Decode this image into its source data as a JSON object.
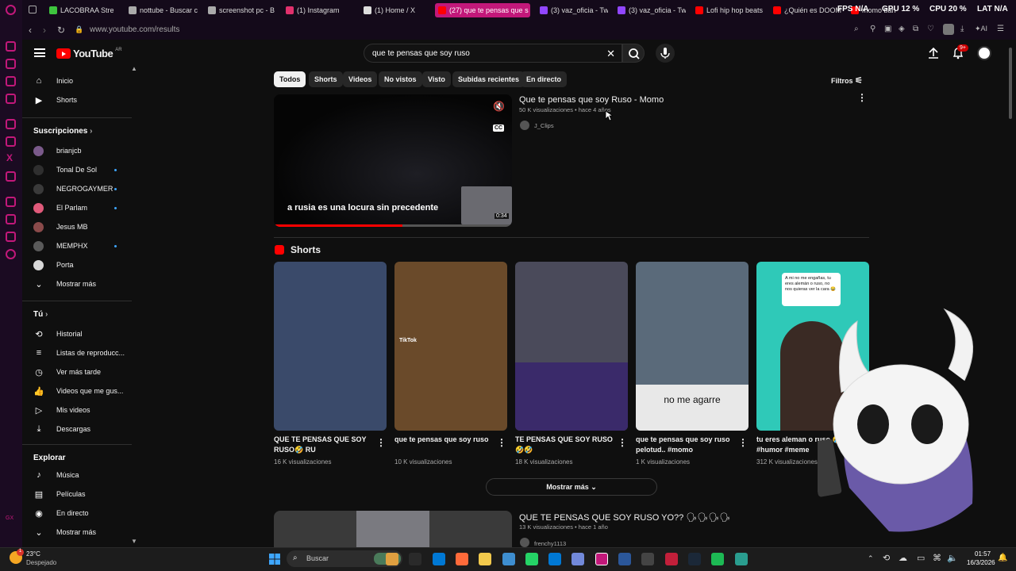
{
  "browser": {
    "tabs": [
      {
        "label": "LACOBRAA Stre",
        "color": "#3ec43e"
      },
      {
        "label": "nottube - Buscar c",
        "color": "#aaaaaa"
      },
      {
        "label": "screenshot pc - B",
        "color": "#aaaaaa"
      },
      {
        "label": "(1) Instagram",
        "color": "#e1306c"
      },
      {
        "label": "(1) Home / X",
        "color": "#dddddd"
      },
      {
        "label": "(27) que te pensas que s",
        "color": "#ff0000"
      },
      {
        "label": "(3) vaz_oficia - Tw",
        "color": "#9146ff"
      },
      {
        "label": "(3) vaz_oficia - Tw",
        "color": "#9146ff"
      },
      {
        "label": "Lofi hip hop beats",
        "color": "#ff0000"
      },
      {
        "label": "¿Quién es DOOM",
        "color": "#ff0000"
      },
      {
        "label": "momo banea a un",
        "color": "#ff0000"
      }
    ],
    "url": "www.youtube.com/results",
    "hud": {
      "fps_label": "FPS",
      "fps": "N/A",
      "gpu_label": "GPU",
      "gpu": "12 %",
      "cpu_label": "CPU",
      "cpu": "20 %",
      "lat_label": "LAT",
      "lat": "N/A"
    },
    "ai_label": "AI"
  },
  "youtube": {
    "logo": "YouTube",
    "region": "AR",
    "search_query": "que te pensas que soy ruso",
    "notification_count": "9+",
    "sidebar": {
      "main": [
        {
          "label": "Inicio",
          "icon": "home-icon"
        },
        {
          "label": "Shorts",
          "icon": "shorts-icon"
        }
      ],
      "subs_title": "Suscripciones",
      "subs": [
        {
          "label": "brianjcb",
          "color": "#7a5a8a",
          "dot": false
        },
        {
          "label": "Tonal De Sol",
          "color": "#2f2f2f",
          "dot": true
        },
        {
          "label": "NEGROGAYMER",
          "color": "#3a3a3a",
          "dot": true
        },
        {
          "label": "El Parlam",
          "color": "#e05a7a",
          "dot": true
        },
        {
          "label": "Jesus MB",
          "color": "#8a4a4a",
          "dot": false
        },
        {
          "label": "MEMPHX",
          "color": "#5a5a5a",
          "dot": true
        },
        {
          "label": "Porta",
          "color": "#d8d8d8",
          "dot": false
        }
      ],
      "subs_more": "Mostrar más",
      "you_title": "Tú",
      "you": [
        {
          "label": "Historial",
          "icon": "history-icon"
        },
        {
          "label": "Listas de reproducc...",
          "icon": "playlist-icon"
        },
        {
          "label": "Ver más tarde",
          "icon": "clock-icon"
        },
        {
          "label": "Videos que me gus...",
          "icon": "thumbs-up-icon"
        },
        {
          "label": "Mis videos",
          "icon": "my-videos-icon"
        },
        {
          "label": "Descargas",
          "icon": "download-icon"
        }
      ],
      "explore_title": "Explorar",
      "explore": [
        {
          "label": "Música",
          "icon": "music-icon"
        },
        {
          "label": "Películas",
          "icon": "film-icon"
        },
        {
          "label": "En directo",
          "icon": "live-icon"
        }
      ],
      "explore_more": "Mostrar más"
    },
    "chips": [
      "Todos",
      "Shorts",
      "Videos",
      "No vistos",
      "Visto",
      "Subidas recientes",
      "En directo"
    ],
    "filters": "Filtros",
    "video1": {
      "title": "Que te pensas que soy Ruso - Momo",
      "meta": "50 K visualizaciones • hace 4 años",
      "channel": "J_Clips",
      "caption": "a rusia es una locura sin precedente",
      "duration": "0:34",
      "progress": 0.54
    },
    "shorts_title": "Shorts",
    "shorts": [
      {
        "title": "QUE TE PENSAS QUE SOY RUSO🤣 RU",
        "views": "16 K visualizaciones",
        "bg": "#3a4a6a"
      },
      {
        "title": "que te pensas que soy ruso",
        "views": "10 K visualizaciones",
        "bg": "#6a4a2a"
      },
      {
        "title": "TE PENSAS QUE SOY RUSO 🤣🤣",
        "views": "18 K visualizaciones",
        "bg": "#4a4a5a"
      },
      {
        "title": "que te pensas que soy ruso pelotud.. #momo",
        "views": "1 K visualizaciones",
        "bg": "#5a6a7a"
      },
      {
        "title": "tu eres aleman o ruso 🤣 #humor #meme",
        "views": "312 K visualizaciones",
        "bg": "#2fc9b8"
      }
    ],
    "short_overlays": {
      "tiktok": "TikTok",
      "subtitle": "no me agarre",
      "chat": "A mi no me engañas, tu eres alemán o ruso, no nos quieras ver la cara 😂"
    },
    "show_more": "Mostrar más",
    "video2": {
      "title": "QUE TE PENSAS QUE SOY RUSO YO?? 🗣🗣🗣🗣",
      "meta": "13 K visualizaciones • hace 1 año",
      "channel": "frenchy1113"
    }
  },
  "taskbar": {
    "weather": "23°C",
    "weather_desc": "Despejado",
    "search": "Buscar",
    "time": "01:57",
    "date": "16/3/2026"
  }
}
